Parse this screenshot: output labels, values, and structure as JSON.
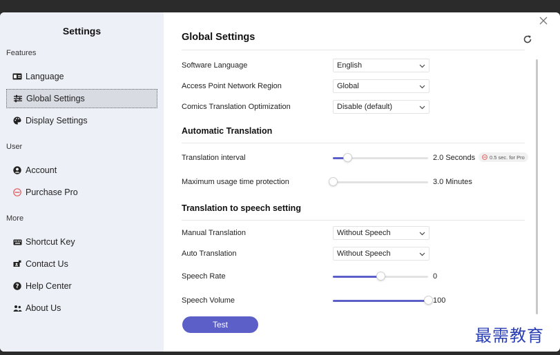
{
  "sidebar": {
    "title": "Settings",
    "sections": [
      {
        "label": "Features",
        "items": [
          {
            "label": "Language",
            "icon": "language-icon"
          },
          {
            "label": "Global Settings",
            "icon": "sliders-icon",
            "active": true
          },
          {
            "label": "Display Settings",
            "icon": "palette-icon"
          }
        ]
      },
      {
        "label": "User",
        "items": [
          {
            "label": "Account",
            "icon": "account-icon"
          },
          {
            "label": "Purchase Pro",
            "icon": "pro-icon"
          }
        ]
      },
      {
        "label": "More",
        "items": [
          {
            "label": "Shortcut Key",
            "icon": "keyboard-icon"
          },
          {
            "label": "Contact Us",
            "icon": "contact-icon"
          },
          {
            "label": "Help Center",
            "icon": "help-icon"
          },
          {
            "label": "About Us",
            "icon": "about-icon"
          }
        ]
      }
    ]
  },
  "main": {
    "title": "Global Settings",
    "general": [
      {
        "label": "Software Language",
        "value": "English"
      },
      {
        "label": "Access Point Network Region",
        "value": "Global"
      },
      {
        "label": "Comics Translation Optimization",
        "value": "Disable (default)"
      }
    ],
    "auto_translation": {
      "title": "Automatic Translation",
      "interval": {
        "label": "Translation interval",
        "value": "2.0 Seconds",
        "fraction": 0.15
      },
      "pro_badge": "0.5 sec. for Pro",
      "max_usage": {
        "label": "Maximum usage time protection",
        "value": "3.0 Minutes",
        "fraction": 0.0
      }
    },
    "speech": {
      "title": "Translation to speech setting",
      "manual": {
        "label": "Manual Translation",
        "value": "Without Speech"
      },
      "auto": {
        "label": "Auto Translation",
        "value": "Without Speech"
      },
      "rate": {
        "label": "Speech Rate",
        "value": "0",
        "fraction": 0.5
      },
      "volume": {
        "label": "Speech Volume",
        "value": "100",
        "fraction": 1.0
      }
    },
    "test_label": "Test"
  },
  "colors": {
    "accent": "#5b5fc7",
    "sidebar_bg": "#eef0f8",
    "active_item": "#d9dbe3"
  },
  "watermark": "最需教育"
}
